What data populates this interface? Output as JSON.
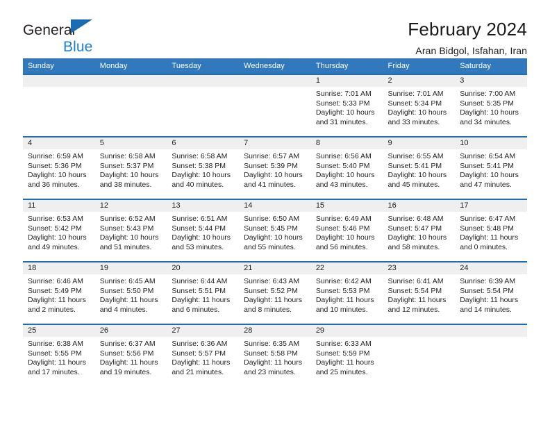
{
  "brand": {
    "name_line1": "General",
    "name_line2": "Blue",
    "colors": {
      "dark": "#231f20",
      "blue": "#1a7fd4",
      "triangle": "#1a6db5"
    }
  },
  "header": {
    "title": "February 2024",
    "subtitle": "Aran Bidgol, Isfahan, Iran"
  },
  "theme": {
    "header_row_bg": "#3179bc",
    "row_divider": "#1f6cb0",
    "daynum_band_bg": "#efefef"
  },
  "weekday_headers": [
    "Sunday",
    "Monday",
    "Tuesday",
    "Wednesday",
    "Thursday",
    "Friday",
    "Saturday"
  ],
  "weeks": [
    [
      {
        "day": "",
        "empty": true
      },
      {
        "day": "",
        "empty": true
      },
      {
        "day": "",
        "empty": true
      },
      {
        "day": "",
        "empty": true
      },
      {
        "day": "1",
        "sunrise": "Sunrise: 7:01 AM",
        "sunset": "Sunset: 5:33 PM",
        "daylight1": "Daylight: 10 hours",
        "daylight2": "and 31 minutes."
      },
      {
        "day": "2",
        "sunrise": "Sunrise: 7:01 AM",
        "sunset": "Sunset: 5:34 PM",
        "daylight1": "Daylight: 10 hours",
        "daylight2": "and 33 minutes."
      },
      {
        "day": "3",
        "sunrise": "Sunrise: 7:00 AM",
        "sunset": "Sunset: 5:35 PM",
        "daylight1": "Daylight: 10 hours",
        "daylight2": "and 34 minutes."
      }
    ],
    [
      {
        "day": "4",
        "sunrise": "Sunrise: 6:59 AM",
        "sunset": "Sunset: 5:36 PM",
        "daylight1": "Daylight: 10 hours",
        "daylight2": "and 36 minutes."
      },
      {
        "day": "5",
        "sunrise": "Sunrise: 6:58 AM",
        "sunset": "Sunset: 5:37 PM",
        "daylight1": "Daylight: 10 hours",
        "daylight2": "and 38 minutes."
      },
      {
        "day": "6",
        "sunrise": "Sunrise: 6:58 AM",
        "sunset": "Sunset: 5:38 PM",
        "daylight1": "Daylight: 10 hours",
        "daylight2": "and 40 minutes."
      },
      {
        "day": "7",
        "sunrise": "Sunrise: 6:57 AM",
        "sunset": "Sunset: 5:39 PM",
        "daylight1": "Daylight: 10 hours",
        "daylight2": "and 41 minutes."
      },
      {
        "day": "8",
        "sunrise": "Sunrise: 6:56 AM",
        "sunset": "Sunset: 5:40 PM",
        "daylight1": "Daylight: 10 hours",
        "daylight2": "and 43 minutes."
      },
      {
        "day": "9",
        "sunrise": "Sunrise: 6:55 AM",
        "sunset": "Sunset: 5:41 PM",
        "daylight1": "Daylight: 10 hours",
        "daylight2": "and 45 minutes."
      },
      {
        "day": "10",
        "sunrise": "Sunrise: 6:54 AM",
        "sunset": "Sunset: 5:41 PM",
        "daylight1": "Daylight: 10 hours",
        "daylight2": "and 47 minutes."
      }
    ],
    [
      {
        "day": "11",
        "sunrise": "Sunrise: 6:53 AM",
        "sunset": "Sunset: 5:42 PM",
        "daylight1": "Daylight: 10 hours",
        "daylight2": "and 49 minutes."
      },
      {
        "day": "12",
        "sunrise": "Sunrise: 6:52 AM",
        "sunset": "Sunset: 5:43 PM",
        "daylight1": "Daylight: 10 hours",
        "daylight2": "and 51 minutes."
      },
      {
        "day": "13",
        "sunrise": "Sunrise: 6:51 AM",
        "sunset": "Sunset: 5:44 PM",
        "daylight1": "Daylight: 10 hours",
        "daylight2": "and 53 minutes."
      },
      {
        "day": "14",
        "sunrise": "Sunrise: 6:50 AM",
        "sunset": "Sunset: 5:45 PM",
        "daylight1": "Daylight: 10 hours",
        "daylight2": "and 55 minutes."
      },
      {
        "day": "15",
        "sunrise": "Sunrise: 6:49 AM",
        "sunset": "Sunset: 5:46 PM",
        "daylight1": "Daylight: 10 hours",
        "daylight2": "and 56 minutes."
      },
      {
        "day": "16",
        "sunrise": "Sunrise: 6:48 AM",
        "sunset": "Sunset: 5:47 PM",
        "daylight1": "Daylight: 10 hours",
        "daylight2": "and 58 minutes."
      },
      {
        "day": "17",
        "sunrise": "Sunrise: 6:47 AM",
        "sunset": "Sunset: 5:48 PM",
        "daylight1": "Daylight: 11 hours",
        "daylight2": "and 0 minutes."
      }
    ],
    [
      {
        "day": "18",
        "sunrise": "Sunrise: 6:46 AM",
        "sunset": "Sunset: 5:49 PM",
        "daylight1": "Daylight: 11 hours",
        "daylight2": "and 2 minutes."
      },
      {
        "day": "19",
        "sunrise": "Sunrise: 6:45 AM",
        "sunset": "Sunset: 5:50 PM",
        "daylight1": "Daylight: 11 hours",
        "daylight2": "and 4 minutes."
      },
      {
        "day": "20",
        "sunrise": "Sunrise: 6:44 AM",
        "sunset": "Sunset: 5:51 PM",
        "daylight1": "Daylight: 11 hours",
        "daylight2": "and 6 minutes."
      },
      {
        "day": "21",
        "sunrise": "Sunrise: 6:43 AM",
        "sunset": "Sunset: 5:52 PM",
        "daylight1": "Daylight: 11 hours",
        "daylight2": "and 8 minutes."
      },
      {
        "day": "22",
        "sunrise": "Sunrise: 6:42 AM",
        "sunset": "Sunset: 5:53 PM",
        "daylight1": "Daylight: 11 hours",
        "daylight2": "and 10 minutes."
      },
      {
        "day": "23",
        "sunrise": "Sunrise: 6:41 AM",
        "sunset": "Sunset: 5:54 PM",
        "daylight1": "Daylight: 11 hours",
        "daylight2": "and 12 minutes."
      },
      {
        "day": "24",
        "sunrise": "Sunrise: 6:39 AM",
        "sunset": "Sunset: 5:54 PM",
        "daylight1": "Daylight: 11 hours",
        "daylight2": "and 14 minutes."
      }
    ],
    [
      {
        "day": "25",
        "sunrise": "Sunrise: 6:38 AM",
        "sunset": "Sunset: 5:55 PM",
        "daylight1": "Daylight: 11 hours",
        "daylight2": "and 17 minutes."
      },
      {
        "day": "26",
        "sunrise": "Sunrise: 6:37 AM",
        "sunset": "Sunset: 5:56 PM",
        "daylight1": "Daylight: 11 hours",
        "daylight2": "and 19 minutes."
      },
      {
        "day": "27",
        "sunrise": "Sunrise: 6:36 AM",
        "sunset": "Sunset: 5:57 PM",
        "daylight1": "Daylight: 11 hours",
        "daylight2": "and 21 minutes."
      },
      {
        "day": "28",
        "sunrise": "Sunrise: 6:35 AM",
        "sunset": "Sunset: 5:58 PM",
        "daylight1": "Daylight: 11 hours",
        "daylight2": "and 23 minutes."
      },
      {
        "day": "29",
        "sunrise": "Sunrise: 6:33 AM",
        "sunset": "Sunset: 5:59 PM",
        "daylight1": "Daylight: 11 hours",
        "daylight2": "and 25 minutes."
      },
      {
        "day": "",
        "empty": true
      },
      {
        "day": "",
        "empty": true
      }
    ]
  ]
}
